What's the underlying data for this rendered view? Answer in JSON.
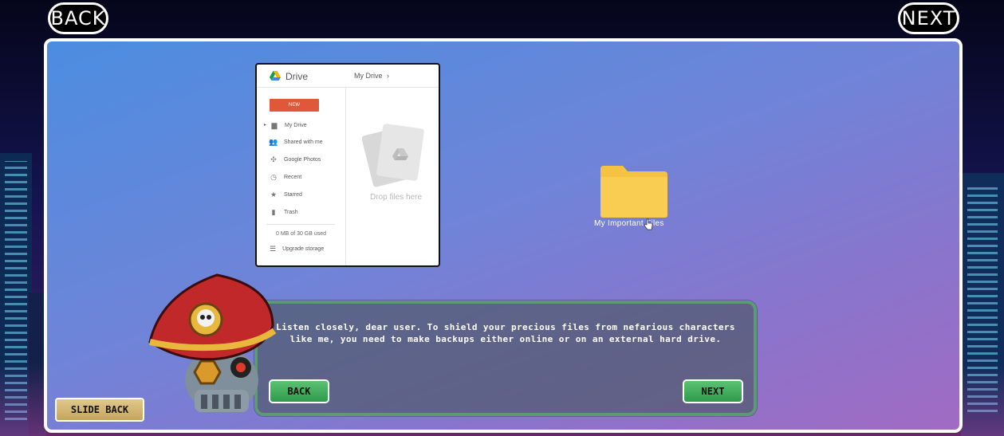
{
  "nav": {
    "back_label": "BACK",
    "next_label": "NEXT"
  },
  "drive": {
    "title": "Drive",
    "breadcrumb": "My Drive",
    "new_label": "NEW",
    "items": [
      {
        "label": "My Drive",
        "icon": "folder-icon"
      },
      {
        "label": "Shared with me",
        "icon": "people-icon"
      },
      {
        "label": "Google Photos",
        "icon": "pinwheel-icon"
      },
      {
        "label": "Recent",
        "icon": "clock-icon"
      },
      {
        "label": "Starred",
        "icon": "star-icon"
      },
      {
        "label": "Trash",
        "icon": "trash-icon"
      }
    ],
    "quota": "0 MB of 30 GB used",
    "upgrade_label": "Upgrade storage",
    "drop_text": "Drop files here"
  },
  "folder": {
    "label": "My Important Files",
    "color": "#f5c242"
  },
  "dialog": {
    "text": "Listen closely, dear user. To shield your precious files from nefarious characters like me, you need to make backups either online or on an external hard drive.",
    "back_label": "BACK",
    "next_label": "NEXT"
  },
  "slide_back_label": "SLIDE BACK",
  "colors": {
    "dialog_border": "#5c9a76",
    "green_button": "#3fae5c",
    "new_button": "#e0583a"
  }
}
